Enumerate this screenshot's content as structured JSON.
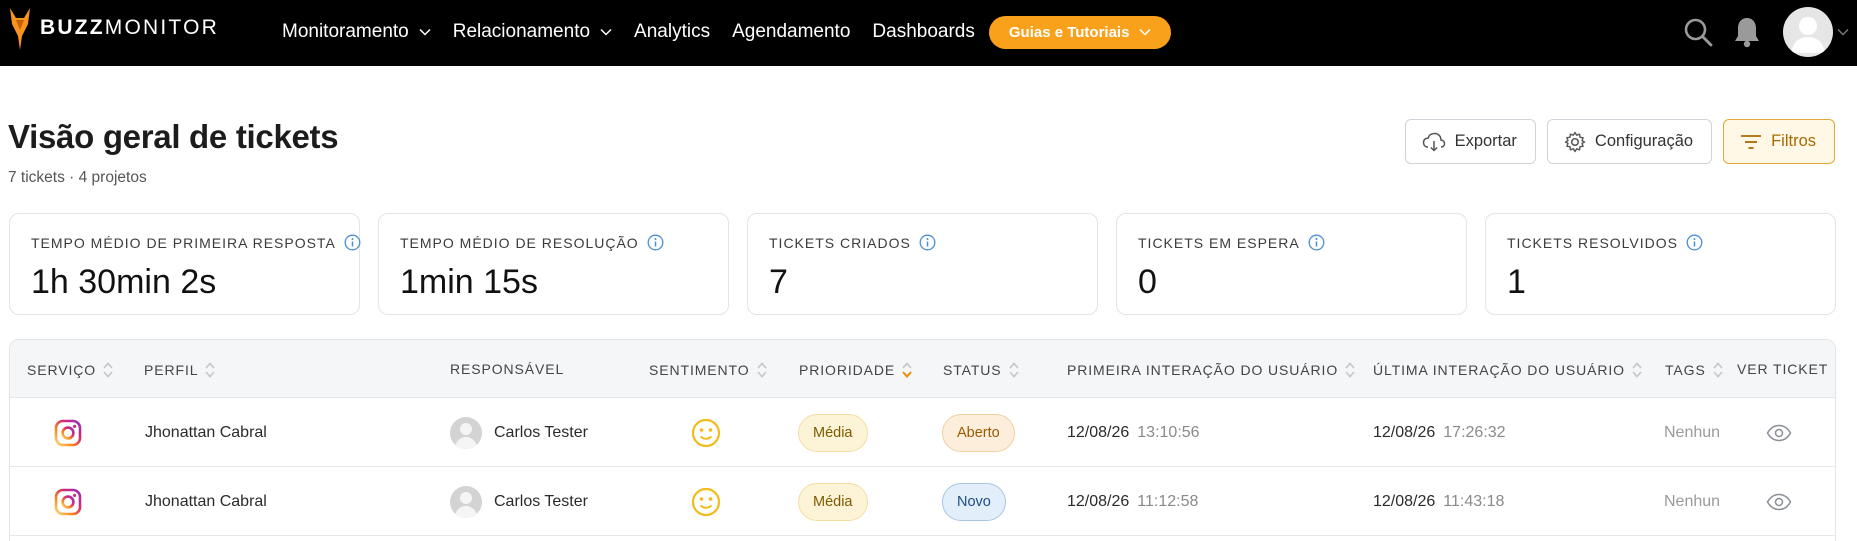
{
  "brand": {
    "name_bold": "BUZZ",
    "name_light": "MONITOR",
    "logo_icon": "fox-logo-icon"
  },
  "nav": {
    "items": [
      {
        "label": "Monitoramento",
        "has_dropdown": true
      },
      {
        "label": "Relacionamento",
        "has_dropdown": true
      },
      {
        "label": "Analytics",
        "has_dropdown": false
      },
      {
        "label": "Agendamento",
        "has_dropdown": false
      },
      {
        "label": "Dashboards",
        "has_dropdown": false
      }
    ],
    "guides_label": "Guias e Tutoriais",
    "icons": [
      "search-icon",
      "bell-icon",
      "user-avatar"
    ]
  },
  "header": {
    "title": "Visão geral de tickets",
    "subtitle": "7 tickets · 4 projetos",
    "actions": {
      "export": "Exportar",
      "config": "Configuração",
      "filters": "Filtros"
    }
  },
  "kpis": [
    {
      "label": "TEMPO MÉDIO DE PRIMEIRA RESPOSTA",
      "value": "1h 30min 2s"
    },
    {
      "label": "TEMPO MÉDIO DE RESOLUÇÃO",
      "value": "1min 15s"
    },
    {
      "label": "TICKETS CRIADOS",
      "value": "7"
    },
    {
      "label": "TICKETS EM ESPERA",
      "value": "0"
    },
    {
      "label": "TICKETS RESOLVIDOS",
      "value": "1"
    }
  ],
  "table": {
    "columns": {
      "servico": "SERVIÇO",
      "perfil": "PERFIL",
      "responsavel": "RESPONSÁVEL",
      "sentimento": "SENTIMENTO",
      "prioridade": "PRIORIDADE",
      "status": "STATUS",
      "primeira": "PRIMEIRA INTERAÇÃO DO USUÁRIO",
      "ultima": "ÚLTIMA INTERAÇÃO DO USUÁRIO",
      "tags": "TAGS",
      "ver": "VER TICKET"
    },
    "sorted_column": "prioridade",
    "rows": [
      {
        "service_icon": "instagram-icon",
        "perfil": "Jhonattan Cabral",
        "responsavel": "Carlos Tester",
        "sentimento_icon": "neutral-smile-icon",
        "prioridade": "Média",
        "status": "Aberto",
        "status_kind": "aberto",
        "primeira_date": "12/08/26",
        "primeira_time": "13:10:56",
        "ultima_date": "12/08/26",
        "ultima_time": "17:26:32",
        "tags": "Nenhun"
      },
      {
        "service_icon": "instagram-icon",
        "perfil": "Jhonattan Cabral",
        "responsavel": "Carlos Tester",
        "sentimento_icon": "neutral-smile-icon",
        "prioridade": "Média",
        "status": "Novo",
        "status_kind": "novo",
        "primeira_date": "12/08/26",
        "primeira_time": "11:12:58",
        "ultima_date": "12/08/26",
        "ultima_time": "11:43:18",
        "tags": "Nenhun"
      }
    ]
  },
  "colors": {
    "topbar": "#000000",
    "accent": "#f9a11b",
    "filters_border": "#e2a83a"
  }
}
